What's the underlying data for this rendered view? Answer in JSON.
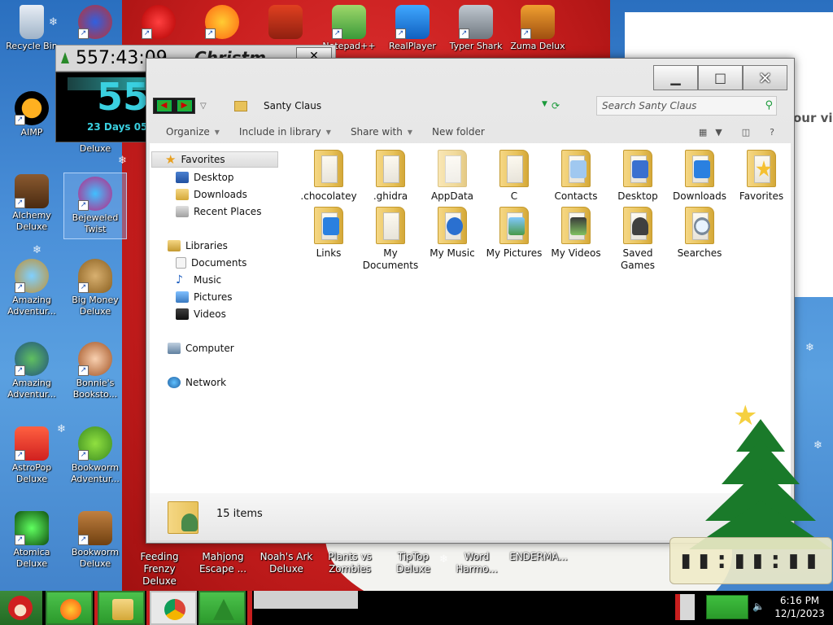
{
  "desktop": {
    "top_icons": [
      {
        "id": "recycle-bin",
        "label": "Recycle Bin"
      },
      {
        "id": "notepadpp",
        "label": "Notepad++"
      },
      {
        "id": "realplayer",
        "label": "RealPlayer"
      },
      {
        "id": "typer-shark",
        "label": "Typer Shark"
      },
      {
        "id": "zuma",
        "label": "Zuma Delux"
      }
    ],
    "left_icons": [
      {
        "id": "aimp",
        "label": "AIMP"
      },
      {
        "id": "alchemy",
        "label": "Alchemy Deluxe"
      },
      {
        "id": "bejeweled",
        "label": "Bejeweled Twist"
      },
      {
        "id": "amazing1",
        "label": "Amazing Adventur..."
      },
      {
        "id": "bigmoney",
        "label": "Big Money Deluxe"
      },
      {
        "id": "amazing2",
        "label": "Amazing Adventur..."
      },
      {
        "id": "bonnies",
        "label": "Bonnie's Booksto..."
      },
      {
        "id": "astropop",
        "label": "AstroPop Deluxe"
      },
      {
        "id": "bookworm-adv",
        "label": "Bookworm Adventur..."
      },
      {
        "id": "atomica",
        "label": "Atomica Deluxe"
      },
      {
        "id": "bookworm",
        "label": "Bookworm Deluxe"
      }
    ],
    "widget_label": "Deluxe",
    "bottom_labels": [
      {
        "id": "feeding",
        "label": "Feeding Frenzy Deluxe"
      },
      {
        "id": "mahjong",
        "label": "Mahjong Escape ..."
      },
      {
        "id": "noahs",
        "label": "Noah's Ark Deluxe"
      },
      {
        "id": "pvz",
        "label": "Plants vs Zombies"
      },
      {
        "id": "tiptop",
        "label": "TipTop Deluxe"
      },
      {
        "id": "word",
        "label": "Word Harmo..."
      },
      {
        "id": "enderman",
        "label": "ENDERMA..."
      }
    ],
    "side_text": "our vi"
  },
  "countdown": {
    "time": "557:43:09",
    "title": "Christm",
    "big": "55",
    "days": "23 Days 05"
  },
  "explorer": {
    "address": "Santy Claus",
    "search_placeholder": "Search Santy Claus",
    "toolbar": {
      "organize": "Organize",
      "include": "Include in library",
      "share": "Share with",
      "new_folder": "New folder"
    },
    "nav": {
      "favorites": "Favorites",
      "fav_items": [
        "Desktop",
        "Downloads",
        "Recent Places"
      ],
      "libraries": "Libraries",
      "lib_items": [
        "Documents",
        "Music",
        "Pictures",
        "Videos"
      ],
      "computer": "Computer",
      "network": "Network"
    },
    "items": [
      ".chocolatey",
      ".ghidra",
      "AppData",
      "C",
      "Contacts",
      "Desktop",
      "Downloads",
      "Favorites",
      "Links",
      "My Documents",
      "My Music",
      "My Pictures",
      "My Videos",
      "Saved Games",
      "Searches"
    ],
    "status": "15 items"
  },
  "taskbar": {
    "time": "6:16 PM",
    "date": "12/1/2023"
  }
}
